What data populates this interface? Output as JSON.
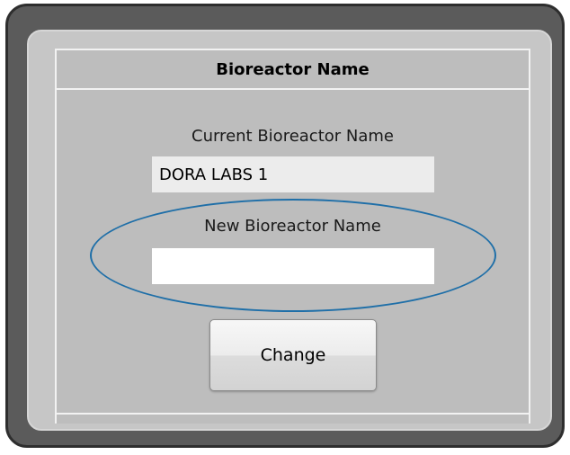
{
  "dialog": {
    "title": "Bioreactor Name",
    "current_name_label": "Current Bioreactor Name",
    "current_name_value": "DORA LABS 1",
    "new_name_label": "New Bioreactor Name",
    "new_name_value": "",
    "change_button_label": "Change"
  },
  "colors": {
    "frame": "#5b5b5b",
    "panel": "#c6c6c6",
    "highlight_ellipse": "#1f6fa8"
  }
}
